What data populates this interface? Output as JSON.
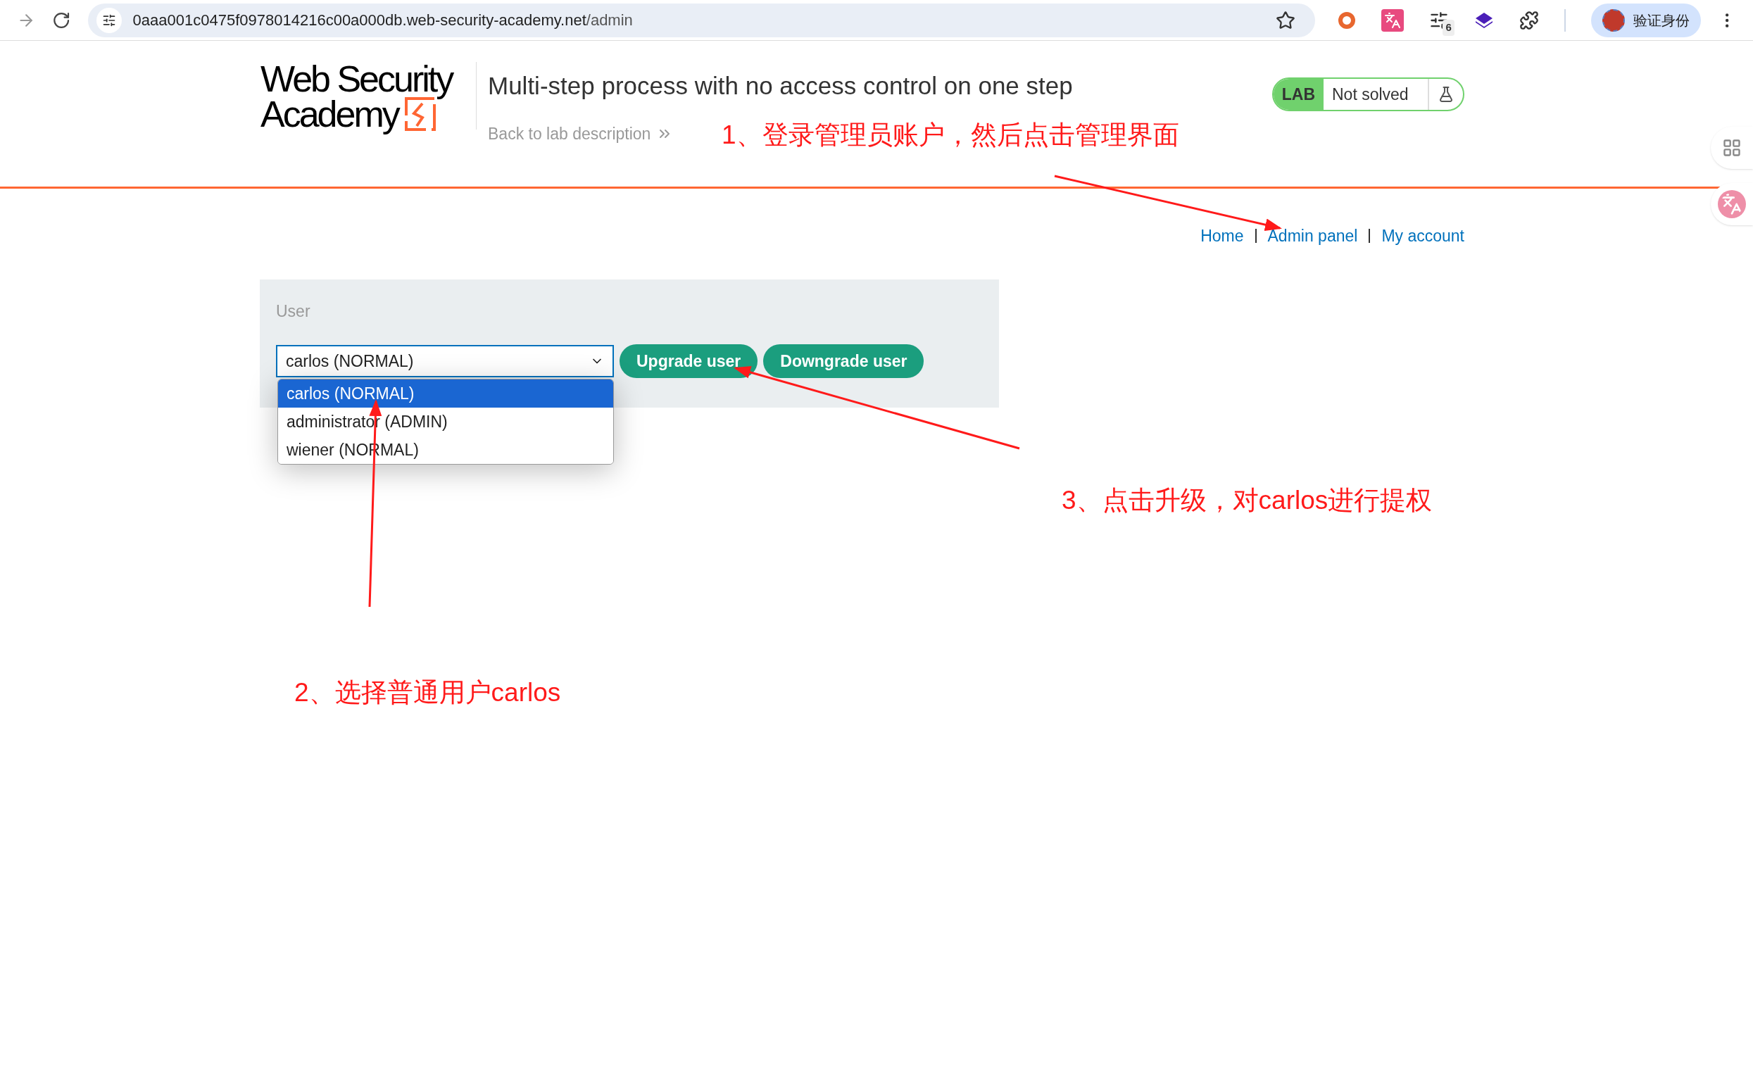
{
  "browser": {
    "url_host": "0aaa001c0475f0978014216c00a000db.web-security-academy.net",
    "url_path": "/admin",
    "extension_badge": "6",
    "profile_button": "验证身份"
  },
  "logo": {
    "line_1": "Web Security",
    "line_2": "Academy"
  },
  "lab": {
    "title": "Multi-step process with no access control on one step",
    "back_link": "Back to lab description",
    "badge": "LAB",
    "status": "Not solved"
  },
  "nav": [
    {
      "label": "Home"
    },
    {
      "label": "Admin panel"
    },
    {
      "label": "My account"
    }
  ],
  "form": {
    "label": "User",
    "select_value": "carlos (NORMAL)",
    "options": [
      {
        "label": "carlos (NORMAL)",
        "selected": true
      },
      {
        "label": "administrator (ADMIN)",
        "selected": false
      },
      {
        "label": "wiener (NORMAL)",
        "selected": false
      }
    ],
    "buttons": [
      "Upgrade user",
      "Downgrade user"
    ]
  },
  "annotations": [
    "1、登录管理员账户，然后点击管理界面",
    "3、点击升级，对carlos进行提权",
    "2、选择普通用户carlos"
  ]
}
